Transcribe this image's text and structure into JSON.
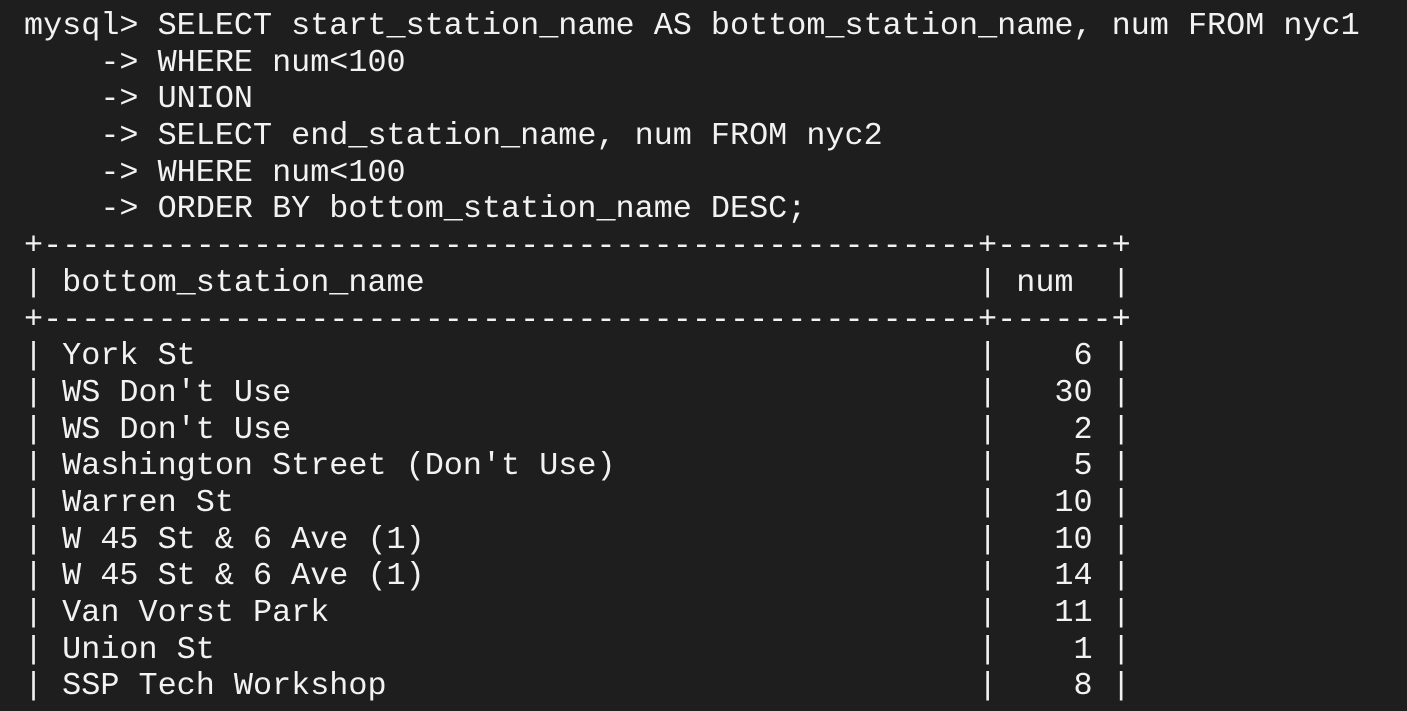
{
  "terminal": {
    "prompt": "mysql> ",
    "continuation": "    -> ",
    "query_lines": [
      "SELECT start_station_name AS bottom_station_name, num FROM nyc1",
      "WHERE num<100",
      "UNION",
      "SELECT end_station_name, num FROM nyc2",
      "WHERE num<100",
      "ORDER BY bottom_station_name DESC;"
    ],
    "table": {
      "headers": [
        "bottom_station_name",
        "num"
      ],
      "rows": [
        [
          "York St",
          "6"
        ],
        [
          "WS Don't Use",
          "30"
        ],
        [
          "WS Don't Use",
          "2"
        ],
        [
          "Washington Street (Don't Use)",
          "5"
        ],
        [
          "Warren St",
          "10"
        ],
        [
          "W 45 St & 6 Ave (1)",
          "10"
        ],
        [
          "W 45 St & 6 Ave (1)",
          "14"
        ],
        [
          "Van Vorst Park",
          "11"
        ],
        [
          "Union St",
          "1"
        ],
        [
          "SSP Tech Workshop",
          "8"
        ]
      ]
    }
  }
}
